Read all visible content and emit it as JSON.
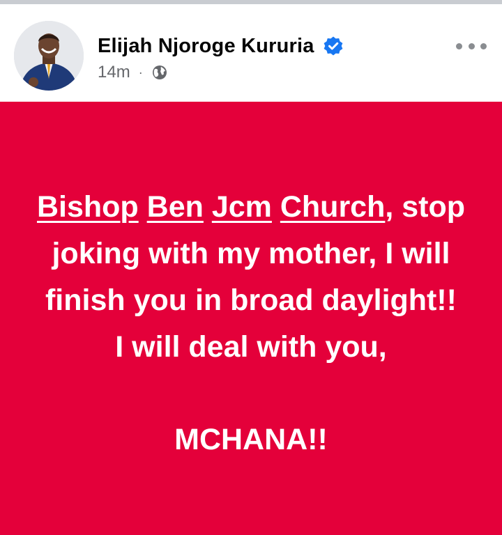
{
  "post": {
    "author": "Elijah Njoroge Kururia",
    "time": "14m",
    "separator": "·",
    "verified_icon": "verified-badge-icon",
    "audience_icon": "globe-icon",
    "more_icon": "more-options-icon",
    "tagged": [
      "Bishop",
      "Ben",
      "Jcm",
      "Church"
    ],
    "message": {
      "line1_tail": ", stop",
      "line2": "joking with my mother, I will",
      "line3": "finish you in broad daylight!!",
      "line4": "I will deal with you,",
      "signoff": "MCHANA!!"
    },
    "background_color": "#e4003a",
    "text_color": "#ffffff",
    "verified_color": "#1877f2",
    "meta_color": "#65676b"
  }
}
